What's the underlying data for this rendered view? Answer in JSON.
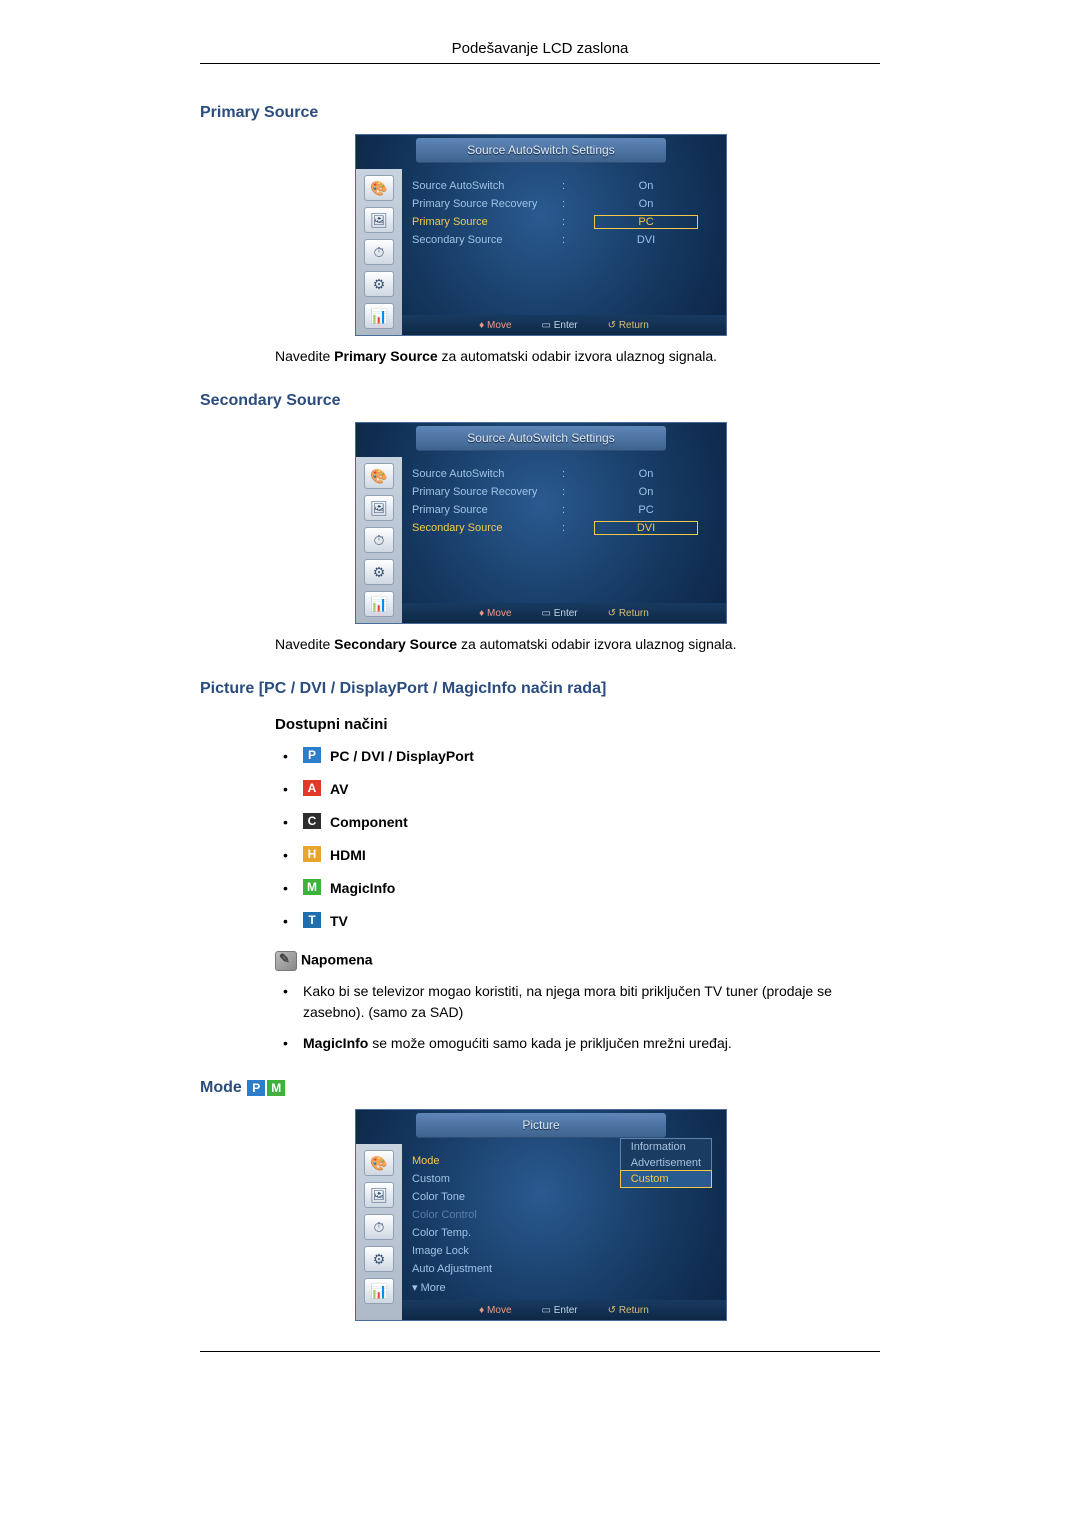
{
  "header_title": "Podešavanje LCD zaslona",
  "h_primary": "Primary Source",
  "para_primary_pre": "Navedite ",
  "para_primary_strong": "Primary Source",
  "para_primary_post": " za automatski odabir izvora ulaznog signala.",
  "h_secondary": "Secondary Source",
  "para_secondary_pre": "Navedite ",
  "para_secondary_strong": "Secondary Source",
  "para_secondary_post": " za automatski odabir izvora ulaznog signala.",
  "h_picture": "Picture [PC / DVI / DisplayPort / MagicInfo način rada]",
  "h_modes": "Dostupni načini",
  "modes": [
    {
      "badge": "P",
      "label": "PC / DVI / DisplayPort",
      "bg": "#2c7ecb"
    },
    {
      "badge": "A",
      "label": "AV",
      "bg": "#e03a2a"
    },
    {
      "badge": "C",
      "label": "Component",
      "bg": "#2e2e2e"
    },
    {
      "badge": "H",
      "label": "HDMI",
      "bg": "#e9a42e"
    },
    {
      "badge": "M",
      "label": "MagicInfo",
      "bg": "#3db33d"
    },
    {
      "badge": "T",
      "label": "TV",
      "bg": "#1f6fb0"
    }
  ],
  "note_label": "Napomena",
  "notes": [
    "Kako bi se televizor mogao koristiti, na njega mora biti priključen TV tuner (prodaje se zasebno). (samo za SAD)",
    {
      "strong": "MagicInfo",
      "text": " se može omogućiti samo kada je priključen mrežni uređaj."
    }
  ],
  "h_mode": "Mode ",
  "osd1": {
    "title": "Source AutoSwitch Settings",
    "rows": [
      {
        "label": "Source AutoSwitch",
        "value": "On"
      },
      {
        "label": "Primary Source Recovery",
        "value": "On"
      },
      {
        "label": "Primary Source",
        "value": "PC",
        "highlight_label": true,
        "box": true
      },
      {
        "label": "Secondary Source",
        "value": "DVI"
      }
    ],
    "footer": {
      "move": "Move",
      "enter": "Enter",
      "return": "Return"
    }
  },
  "osd2": {
    "title": "Source AutoSwitch Settings",
    "rows": [
      {
        "label": "Source AutoSwitch",
        "value": "On"
      },
      {
        "label": "Primary Source Recovery",
        "value": "On"
      },
      {
        "label": "Primary Source",
        "value": "PC"
      },
      {
        "label": "Secondary Source",
        "value": "DVI",
        "highlight_label": true,
        "box": true
      }
    ],
    "footer": {
      "move": "Move",
      "enter": "Enter",
      "return": "Return"
    }
  },
  "osd3": {
    "title": "Picture",
    "rows": [
      {
        "label": "Mode",
        "highlight_label": true
      },
      {
        "label": "Custom"
      },
      {
        "label": "Color Tone"
      },
      {
        "label": "Color Control",
        "dim": true
      },
      {
        "label": "Color Temp."
      },
      {
        "label": "Image Lock"
      },
      {
        "label": "Auto Adjustment"
      },
      {
        "label": "▾ More"
      }
    ],
    "dropdown": [
      {
        "label": "Information",
        "sel": false
      },
      {
        "label": "Advertisement",
        "sel": false
      },
      {
        "label": "Custom",
        "sel": true
      }
    ],
    "footer": {
      "move": "Move",
      "enter": "Enter",
      "return": "Return"
    }
  }
}
